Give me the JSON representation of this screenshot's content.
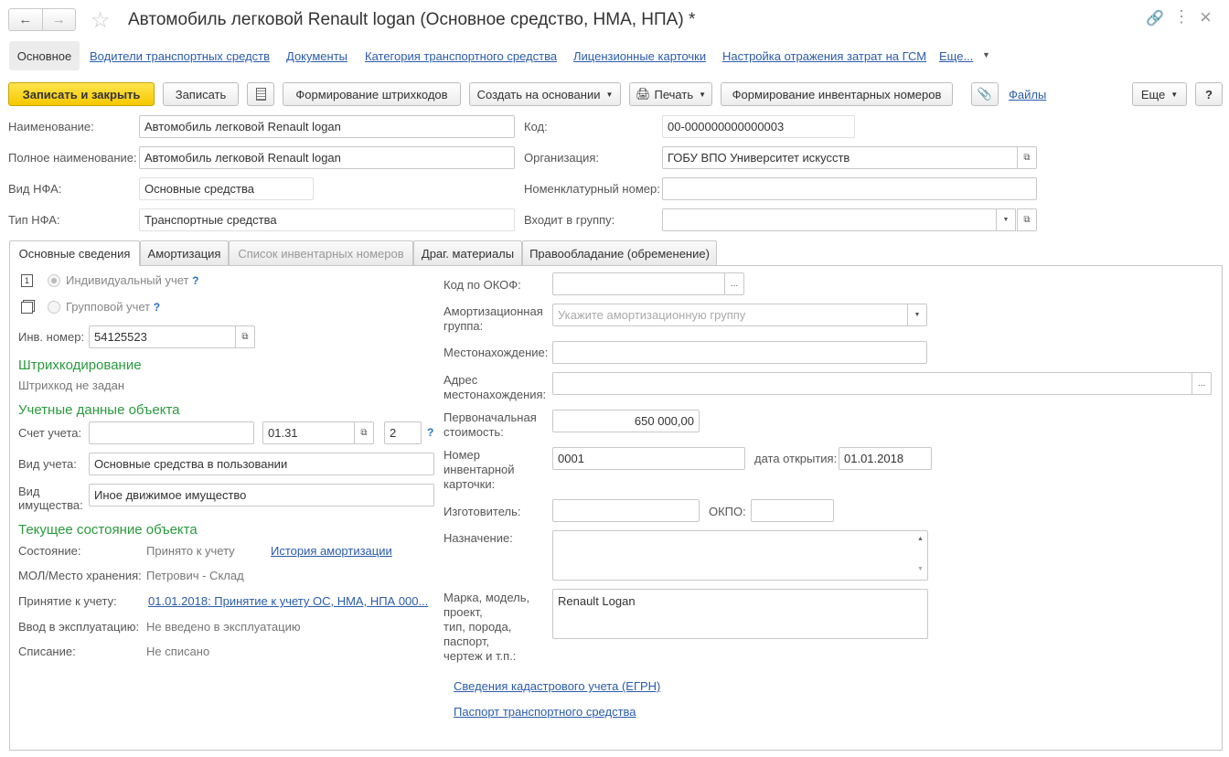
{
  "window": {
    "title": "Автомобиль легковой Renault logan (Основное средство, НМА, НПА) *"
  },
  "nav": {
    "main": "Основное",
    "links": [
      "Водители транспортных средств",
      "Документы",
      "Категория транспортного средства",
      "Лицензионные карточки",
      "Настройка отражения затрат на ГСМ",
      "Еще..."
    ]
  },
  "toolbar": {
    "save_close": "Записать и закрыть",
    "save": "Записать",
    "barcodes": "Формирование штрихкодов",
    "create_basis": "Создать на основании",
    "print": "Печать",
    "inv_numbers": "Формирование инвентарных номеров",
    "files": "Файлы",
    "more": "Еще",
    "help": "?"
  },
  "header": {
    "name_label": "Наименование:",
    "name_value": "Автомобиль легковой Renault logan",
    "full_name_label": "Полное наименование:",
    "full_name_value": "Автомобиль легковой Renault logan",
    "nfa_kind_label": "Вид НФА:",
    "nfa_kind_value": "Основные средства",
    "nfa_type_label": "Тип НФА:",
    "nfa_type_value": "Транспортные средства",
    "code_label": "Код:",
    "code_value": "00-000000000000003",
    "org_label": "Организация:",
    "org_value": "ГОБУ ВПО Университет искусств",
    "nomenclature_label": "Номенклатурный номер:",
    "nomenclature_value": "",
    "group_label": "Входит в группу:",
    "group_value": ""
  },
  "tabs": [
    "Основные сведения",
    "Амортизация",
    "Список инвентарных номеров",
    "Драг. материалы",
    "Правообладание (обременение)"
  ],
  "left": {
    "individual": "Индивидуальный учет",
    "group": "Групповой учет",
    "inv_label": "Инв. номер:",
    "inv_value": "54125523",
    "barcode_section": "Штрихкодирование",
    "barcode_status": "Штрихкод не задан",
    "accounting_section": "Учетные данные объекта",
    "account_label": "Счет учета:",
    "account_value1": "",
    "account_value2": "01.31",
    "account_value3": "2",
    "accounting_kind_label": "Вид учета:",
    "accounting_kind_value": "Основные средства в пользовании",
    "property_kind_label1": "Вид",
    "property_kind_label2": "имущества:",
    "property_kind_value": "Иное движимое имущество",
    "state_section": "Текущее состояние объекта",
    "state_label": "Состояние:",
    "state_value": "Принято к учету",
    "depreciation_history": "История амортизации",
    "mol_label": "МОЛ/Место хранения:",
    "mol_value": "Петрович - Склад",
    "acceptance_label": "Принятие к учету:",
    "acceptance_value": "01.01.2018: Принятие к учету ОС, НМА, НПА 000...",
    "commissioning_label": "Ввод в эксплуатацию:",
    "commissioning_value": "Не введено в эксплуатацию",
    "writeoff_label": "Списание:",
    "writeoff_value": "Не списано"
  },
  "right": {
    "okof_label": "Код по ОКОФ:",
    "okof_value": "",
    "amort_group_label1": "Амортизационная",
    "amort_group_label2": "группа:",
    "amort_group_placeholder": "Укажите амортизационную группу",
    "location_label": "Местонахождение:",
    "location_value": "",
    "address_label1": "Адрес",
    "address_label2": "местонахождения:",
    "address_value": "",
    "cost_label1": "Первоначальная",
    "cost_label2": "стоимость:",
    "cost_value": "650 000,00",
    "card_label1": "Номер",
    "card_label2": "инвентарной",
    "card_label3": "карточки:",
    "card_value": "0001",
    "open_date_label": "дата открытия:",
    "open_date_value": "01.01.2018",
    "manufacturer_label": "Изготовитель:",
    "manufacturer_value": "",
    "okpo_label": "ОКПО:",
    "okpo_value": "",
    "purpose_label": "Назначение:",
    "purpose_value": "",
    "brand_label1": "Марка, модель,",
    "brand_label2": "проект,",
    "brand_label3": "тип, порода,",
    "brand_label4": "паспорт,",
    "brand_label5": "чертеж и т.п.:",
    "brand_value": "Renault Logan",
    "cadastral_link": "Сведения кадастрового учета (ЕГРН)",
    "passport_link": "Паспорт транспортного средства"
  },
  "colors": {
    "accent_yellow": "#f6c800",
    "link_blue": "#2b5cab",
    "section_green": "#2a9a3d"
  },
  "icons": [
    "arrow-left-icon",
    "arrow-right-icon",
    "star-icon",
    "link-icon",
    "more-icon",
    "close-icon",
    "document-icon",
    "printer-icon",
    "paperclip-icon",
    "open-icon",
    "dropdown-icon",
    "ellipsis-icon",
    "help-icon"
  ]
}
